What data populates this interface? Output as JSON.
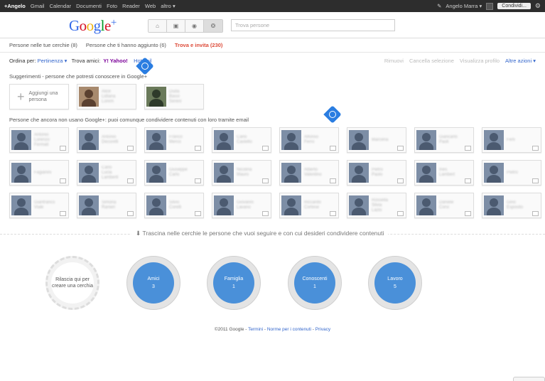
{
  "topbar": {
    "nav": [
      "+Angelo",
      "Gmail",
      "Calendar",
      "Documenti",
      "Foto",
      "Reader",
      "Web",
      "altro ▾"
    ],
    "user": "Angelo Marra ▾",
    "share_label": "Condividi..."
  },
  "header": {
    "logo_g": "G",
    "logo_o1": "o",
    "logo_o2": "o",
    "logo_g2": "g",
    "logo_l": "l",
    "logo_e": "e",
    "logo_plus": "+",
    "search_placeholder": "Trova persone"
  },
  "tabs": [
    "Persone nelle tue cerchie (8)",
    "Persone che ti hanno aggiunto (6)",
    "Trova e invita (230)"
  ],
  "toolbar": {
    "sort_label": "Ordina per:",
    "sort_value": "Pertinenza ▾",
    "find_label": "Trova amici:",
    "yahoo": "Y! Yahoo!",
    "hotmail": "Hotmail",
    "actions": [
      "Rimuovi",
      "Cancella selezione",
      "Visualizza profilo"
    ],
    "more": "Altre azioni ▾"
  },
  "suggestions": {
    "label": "Suggerimenti - persone che potresti conoscere in Google+",
    "add_label": "Aggiungi una persona",
    "people": [
      {
        "line1": "Alice",
        "line2": "Lidiana",
        "line3": "Lorem"
      },
      {
        "line1": "Duda",
        "line2": "Bassi",
        "line3": "Sereni"
      }
    ]
  },
  "email_people": {
    "label": "Persone che ancora non usano Google+: puoi comunque condividere contenuti con loro tramite email",
    "rows": [
      [
        {
          "line1": "Antonio",
          "line2": "Lorenzo",
          "line3": "Fermati"
        },
        {
          "line1": "Antonio",
          "line2": "Decorelli"
        },
        {
          "line1": "Franco",
          "line2": "Merco"
        },
        {
          "line1": "Carlo",
          "line2": "Castello"
        },
        {
          "line1": "Alfonso",
          "line2": "Ferro"
        },
        {
          "line1": "Marcena"
        },
        {
          "line1": "Giancarlo",
          "line2": "Paoli"
        },
        {
          "line1": "Ferli"
        }
      ],
      [
        {
          "line1": "Fagianini"
        },
        {
          "line1": "Carlo",
          "line2": "Lucia",
          "line3": "Lamberti"
        },
        {
          "line1": "Giuseppe",
          "line2": "Carlo"
        },
        {
          "line1": "Nicolina",
          "line2": "Mauro"
        },
        {
          "line1": "Alberto",
          "line2": "Valentino"
        },
        {
          "line1": "Pietro",
          "line2": "Paolo"
        },
        {
          "line1": "Ines",
          "line2": "Lambert"
        },
        {
          "line1": "Pietro"
        }
      ],
      [
        {
          "line1": "Gianfranco",
          "line2": "Viale"
        },
        {
          "line1": "Simona",
          "line2": "Ranieri"
        },
        {
          "line1": "Silvio",
          "line2": "Corelli"
        },
        {
          "line1": "Giovanni",
          "line2": "Lavano"
        },
        {
          "line1": "Riccardo",
          "line2": "Cortese"
        },
        {
          "line1": "Rossella",
          "line2": "Silvia",
          "line3": "Lazio"
        },
        {
          "line1": "Daniele",
          "line2": "Corsi"
        },
        {
          "line1": "Gino",
          "line2": "Esposito"
        }
      ]
    ]
  },
  "drag_text": "Trascina nelle cerchie le persone che vuoi seguire e con cui desideri condividere contenuti",
  "circles": [
    {
      "name": "Rilascia qui per creare una cerchia",
      "count": ""
    },
    {
      "name": "Amici",
      "count": "3"
    },
    {
      "name": "Famiglia",
      "count": "1"
    },
    {
      "name": "Conoscenti",
      "count": "1"
    },
    {
      "name": "Lavoro",
      "count": "5"
    }
  ],
  "footer": {
    "copyright": "©2011 Google -",
    "terms": "Termini",
    "sep1": " - ",
    "policies": "Norme per i contenuti",
    "sep2": " - ",
    "privacy": "Privacy"
  },
  "colors": {
    "accent": "#dd4b39",
    "link": "#3366cc",
    "circle": "#4a90d9",
    "topbar": "#2d2d2d"
  }
}
